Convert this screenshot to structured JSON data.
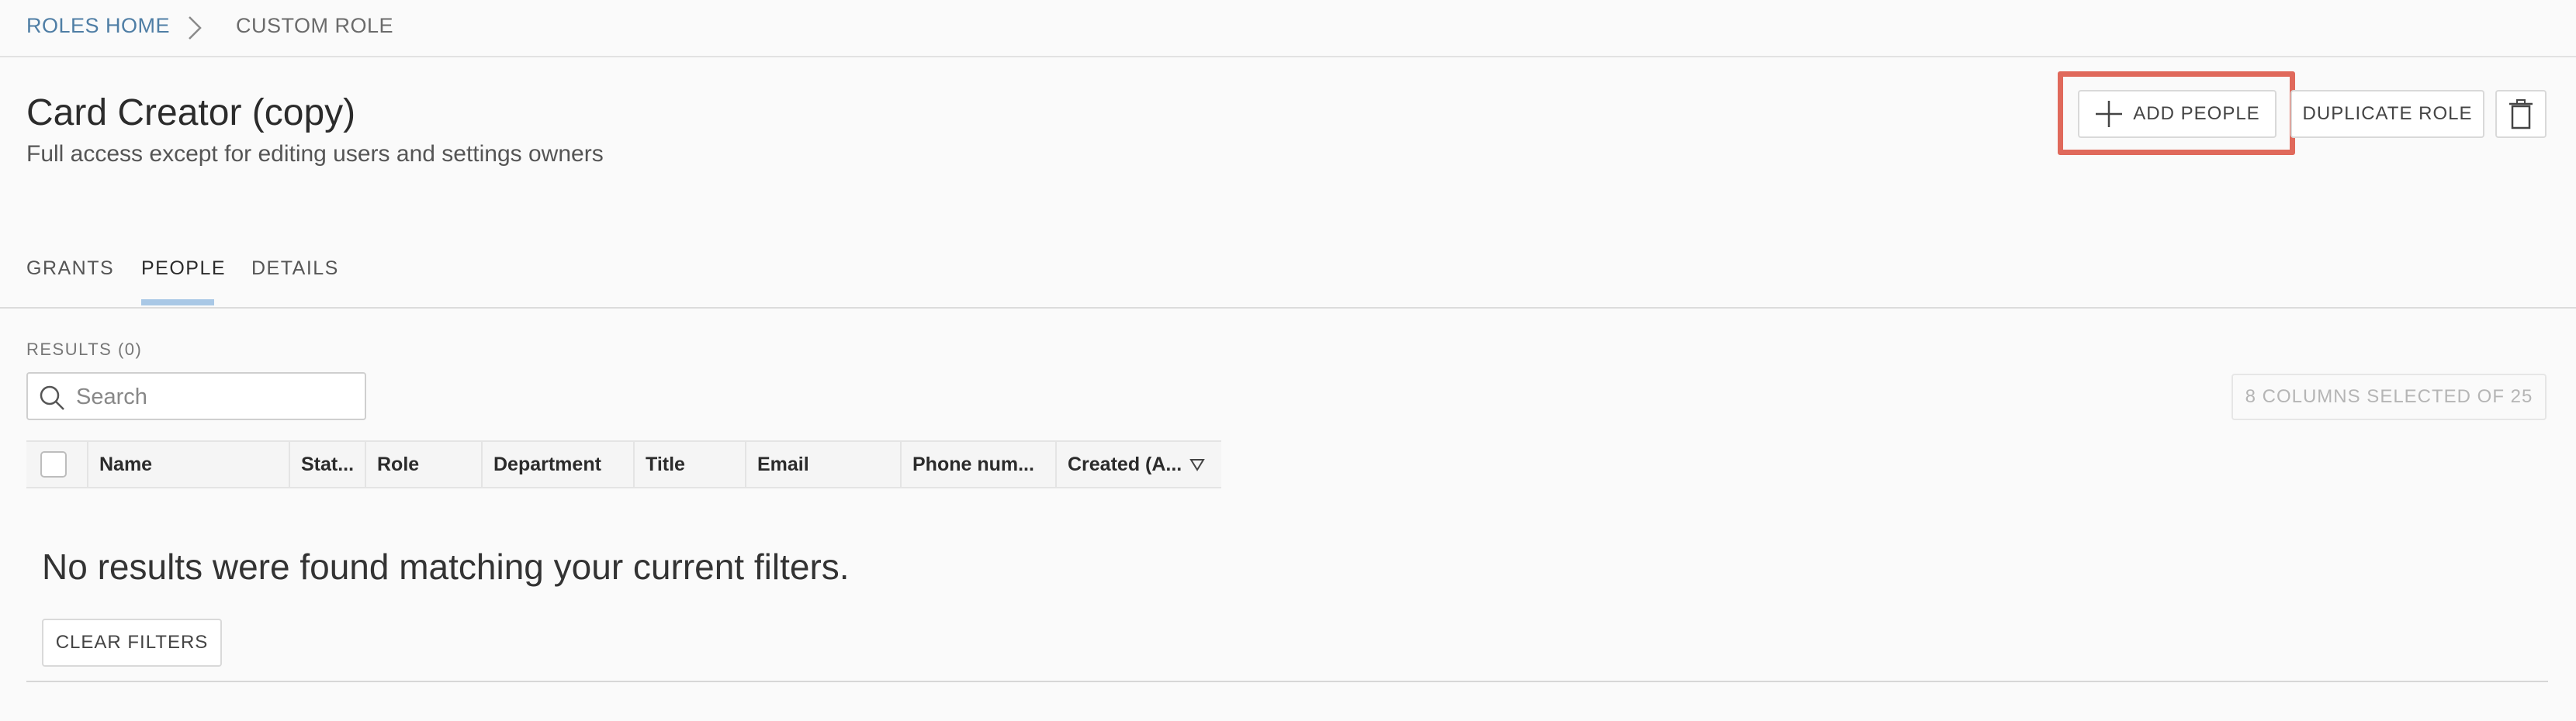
{
  "breadcrumb": {
    "home": "ROLES HOME",
    "current": "CUSTOM ROLE"
  },
  "header": {
    "title": "Card Creator (copy)",
    "subtitle": "Full access except for editing users and settings owners"
  },
  "actions": {
    "add_people": "ADD PEOPLE",
    "duplicate_role": "DUPLICATE ROLE",
    "delete_icon": "trash-icon",
    "highlight_color": "#e0695b"
  },
  "tabs": [
    {
      "label": "GRANTS"
    },
    {
      "label": "PEOPLE",
      "active": true
    },
    {
      "label": "DETAILS"
    }
  ],
  "results": {
    "label": "RESULTS (0)",
    "search_placeholder": "Search",
    "columns_button": "8 COLUMNS SELECTED OF 25"
  },
  "table": {
    "columns": [
      "Name",
      "Stat...",
      "Role",
      "Department",
      "Title",
      "Email",
      "Phone num...",
      "Created (A..."
    ]
  },
  "empty_state": {
    "message": "No results were found matching your current filters.",
    "clear_filters": "CLEAR FILTERS"
  },
  "colors": {
    "link": "#4f7ea5",
    "tab_underline": "#a9c8e6"
  }
}
